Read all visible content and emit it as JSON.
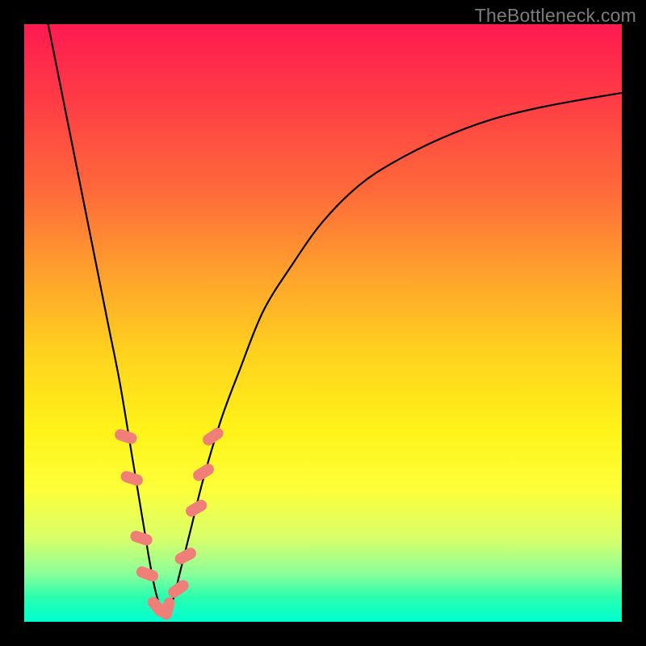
{
  "watermark": "TheBottleneck.com",
  "colors": {
    "gradient_top": "#ff1a50",
    "gradient_bottom": "#00ffd0",
    "curve": "#000000",
    "marker": "#f07f7a",
    "frame": "#000000"
  },
  "chart_data": {
    "type": "line",
    "title": "",
    "xlabel": "",
    "ylabel": "",
    "xlim": [
      0,
      100
    ],
    "ylim": [
      0,
      100
    ],
    "grid": false,
    "legend": false,
    "series": [
      {
        "name": "curve",
        "x": [
          4,
          6,
          8,
          10,
          12,
          14,
          16,
          18,
          20,
          21,
          22,
          23,
          24,
          25,
          26,
          28,
          30,
          33,
          36,
          40,
          45,
          50,
          56,
          62,
          70,
          78,
          86,
          94,
          100
        ],
        "y": [
          100,
          90,
          80,
          70,
          60,
          50,
          40,
          28,
          16,
          10,
          5,
          2,
          2,
          4,
          8,
          16,
          24,
          34,
          42,
          52,
          60,
          67,
          73,
          77,
          81,
          84,
          86,
          87.5,
          88.5
        ]
      }
    ],
    "markers": [
      {
        "x": 17.0,
        "y": 31,
        "rot": -72
      },
      {
        "x": 18.0,
        "y": 24,
        "rot": -72
      },
      {
        "x": 19.6,
        "y": 14,
        "rot": -72
      },
      {
        "x": 20.6,
        "y": 8,
        "rot": -70
      },
      {
        "x": 22.2,
        "y": 2.5,
        "rot": -40
      },
      {
        "x": 24.0,
        "y": 2.2,
        "rot": 15
      },
      {
        "x": 25.8,
        "y": 5.5,
        "rot": 55
      },
      {
        "x": 27.0,
        "y": 11,
        "rot": 62
      },
      {
        "x": 28.8,
        "y": 19,
        "rot": 60
      },
      {
        "x": 30.0,
        "y": 25,
        "rot": 58
      },
      {
        "x": 31.6,
        "y": 31,
        "rot": 55
      }
    ]
  }
}
